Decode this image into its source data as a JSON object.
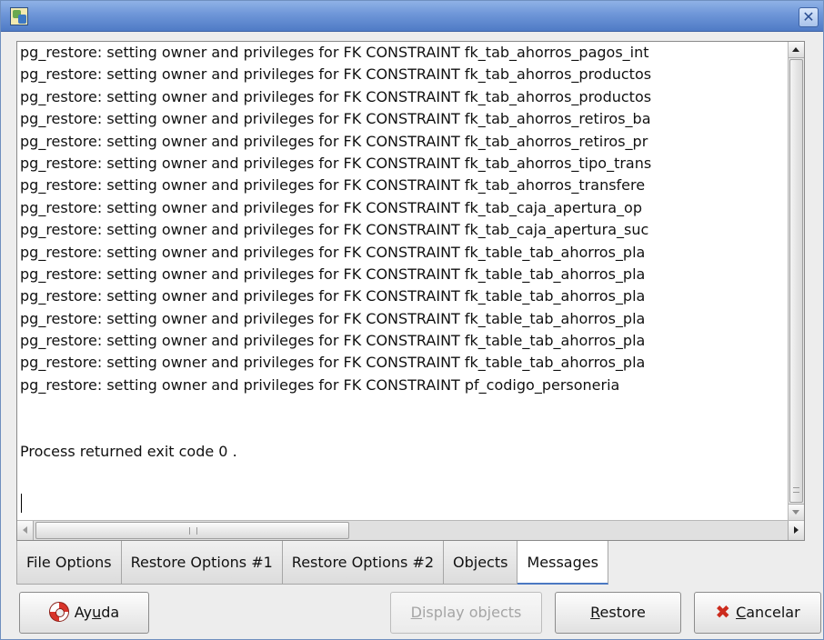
{
  "window": {
    "title": "",
    "app_icon": "pgadmin-app-icon",
    "close_label": "✕"
  },
  "log": {
    "lines": [
      "pg_restore: setting owner and privileges for FK CONSTRAINT fk_tab_ahorros_pagos_int",
      "pg_restore: setting owner and privileges for FK CONSTRAINT fk_tab_ahorros_productos",
      "pg_restore: setting owner and privileges for FK CONSTRAINT fk_tab_ahorros_productos",
      "pg_restore: setting owner and privileges for FK CONSTRAINT fk_tab_ahorros_retiros_ba",
      "pg_restore: setting owner and privileges for FK CONSTRAINT fk_tab_ahorros_retiros_pr",
      "pg_restore: setting owner and privileges for FK CONSTRAINT fk_tab_ahorros_tipo_trans",
      "pg_restore: setting owner and privileges for FK CONSTRAINT fk_tab_ahorros_transfere",
      "pg_restore: setting owner and privileges for FK CONSTRAINT fk_tab_caja_apertura_op",
      "pg_restore: setting owner and privileges for FK CONSTRAINT fk_tab_caja_apertura_suc",
      "pg_restore: setting owner and privileges for FK CONSTRAINT fk_table_tab_ahorros_pla",
      "pg_restore: setting owner and privileges for FK CONSTRAINT fk_table_tab_ahorros_pla",
      "pg_restore: setting owner and privileges for FK CONSTRAINT fk_table_tab_ahorros_pla",
      "pg_restore: setting owner and privileges for FK CONSTRAINT fk_table_tab_ahorros_pla",
      "pg_restore: setting owner and privileges for FK CONSTRAINT fk_table_tab_ahorros_pla",
      "pg_restore: setting owner and privileges for FK CONSTRAINT fk_table_tab_ahorros_pla",
      "pg_restore: setting owner and privileges for FK CONSTRAINT pf_codigo_personeria",
      "",
      "",
      "Process returned exit code 0 ."
    ]
  },
  "tabs": [
    {
      "label": "File Options",
      "active": false
    },
    {
      "label": "Restore Options #1",
      "active": false
    },
    {
      "label": "Restore Options #2",
      "active": false
    },
    {
      "label": "Objects",
      "active": false
    },
    {
      "label": "Messages",
      "active": true
    }
  ],
  "buttons": {
    "help": {
      "pre": "Ay",
      "mnemonic": "u",
      "post": "da",
      "icon": "lifebuoy-icon"
    },
    "display_objects": {
      "mnemonic": "D",
      "post": "isplay objects",
      "enabled": false
    },
    "restore": {
      "mnemonic": "R",
      "post": "estore"
    },
    "cancel": {
      "mnemonic": "C",
      "post": "ancelar",
      "icon": "cancel-x-icon"
    }
  },
  "colors": {
    "titlebar": "#6e96d8",
    "active_tab_indicator": "#4a78c2",
    "cancel_icon": "#cc2b1d"
  }
}
